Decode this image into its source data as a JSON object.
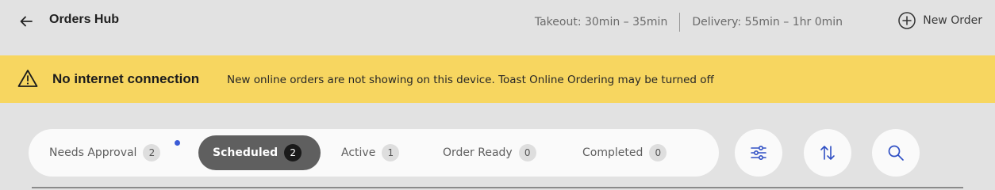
{
  "header": {
    "title": "Orders Hub",
    "takeout": "Takeout: 30min – 35min",
    "delivery": "Delivery: 55min – 1hr 0min",
    "new_order_label": "New Order"
  },
  "banner": {
    "title": "No internet connection",
    "message": "New online orders are not showing on this device. Toast Online Ordering may be turned off"
  },
  "tabs": [
    {
      "label": "Needs Approval",
      "count": "2"
    },
    {
      "label": "Scheduled",
      "count": "2"
    },
    {
      "label": "Active",
      "count": "1"
    },
    {
      "label": "Order Ready",
      "count": "0"
    },
    {
      "label": "Completed",
      "count": "0"
    }
  ],
  "active_tab": "Scheduled",
  "icons": {
    "back": "arrow-left-icon",
    "new_order": "plus-circle-icon",
    "warning": "warning-triangle-icon",
    "filter": "sliders-icon",
    "sort": "sort-arrows-icon",
    "search": "search-icon"
  },
  "colors": {
    "banner": "#f7d660",
    "active_tab": "#5f5f5f",
    "accent": "#3b5bd6",
    "background": "#e2e2e2"
  }
}
